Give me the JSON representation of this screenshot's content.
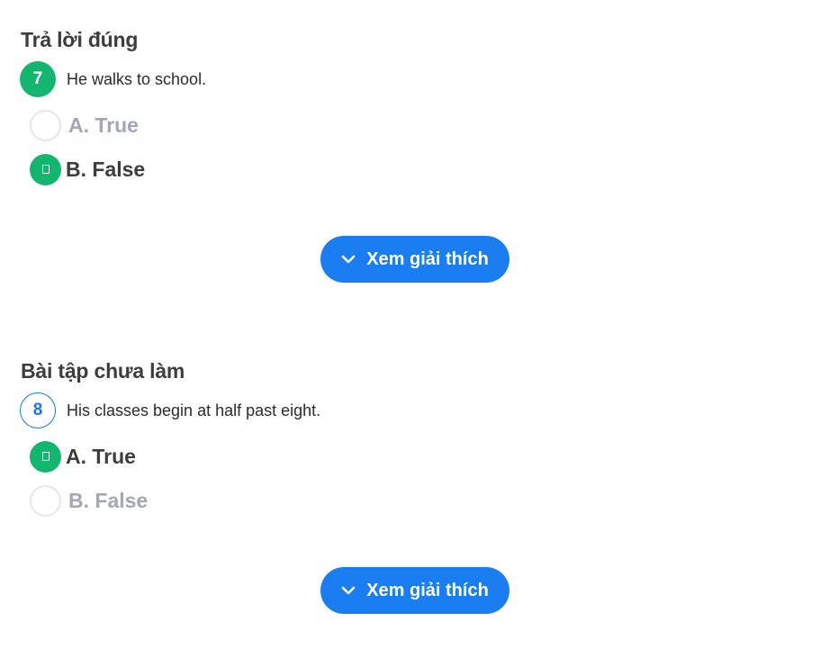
{
  "questions": [
    {
      "status": "Trả lời đúng",
      "number": "7",
      "text": "He walks to school.",
      "options": [
        {
          "label": "A. True",
          "selected": false
        },
        {
          "label": "B. False",
          "selected": true
        }
      ],
      "explain_label": "Xem giải thích"
    },
    {
      "status": "Bài tập chưa làm",
      "number": "8",
      "text": "His classes begin at half past eight.",
      "options": [
        {
          "label": "A. True",
          "selected": true
        },
        {
          "label": "B. False",
          "selected": false
        }
      ],
      "explain_label": "Xem giải thích"
    }
  ],
  "icons": {
    "explain": "chevron-down-icon",
    "selected_option": "check-icon"
  },
  "colors": {
    "correct_green": "#13b66f",
    "primary_blue": "#1a7ef0",
    "muted_gray": "#a3a7b0"
  }
}
